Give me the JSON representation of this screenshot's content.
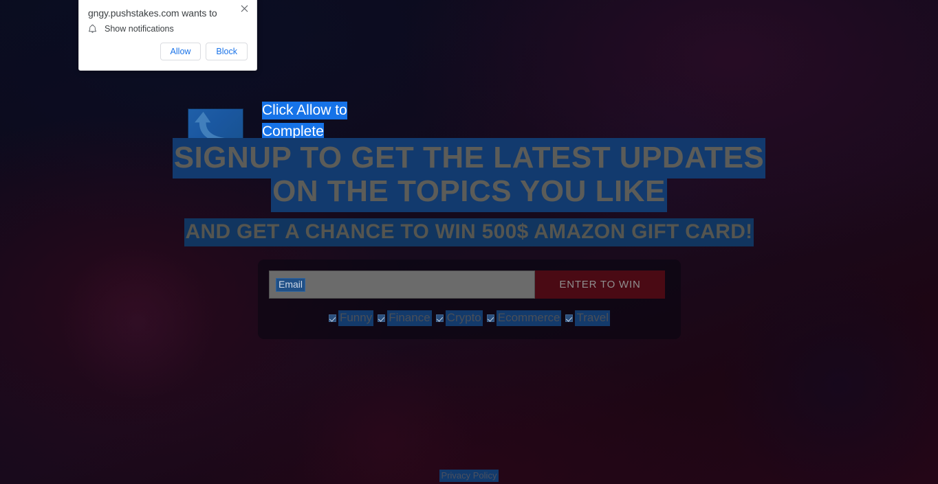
{
  "permission_dialog": {
    "title": "gngy.pushstakes.com wants to",
    "request_label": "Show notifications",
    "bell_icon": "bell-icon",
    "close_icon": "close-icon",
    "allow_label": "Allow",
    "block_label": "Block"
  },
  "page": {
    "logo_icon": "swoosh-arrow-logo",
    "click_allow_text": "Click Allow to Complete",
    "headline_line1": "SIGNUP TO GET THE LATEST UPDATES",
    "headline_line2": "ON THE TOPICS YOU LIKE",
    "subheadline": "AND GET A CHANCE TO WIN 500$ AMAZON GIFT CARD!",
    "privacy_label": "Privacy Policy"
  },
  "form": {
    "email_placeholder": "Email",
    "email_value": "",
    "submit_label": "ENTER TO WIN",
    "topics": [
      {
        "label": "Funny",
        "checked": true
      },
      {
        "label": "Finance",
        "checked": true
      },
      {
        "label": "Crypto",
        "checked": true
      },
      {
        "label": "Ecommerce",
        "checked": true
      },
      {
        "label": "Travel",
        "checked": true
      }
    ]
  },
  "colors": {
    "selection_blue": "#1673e8",
    "submit_button_red": "#4a0a14",
    "logo_blue": "#1a57a0",
    "dialog_link_blue": "#1a73e8",
    "input_gray": "#6b6b6b"
  }
}
